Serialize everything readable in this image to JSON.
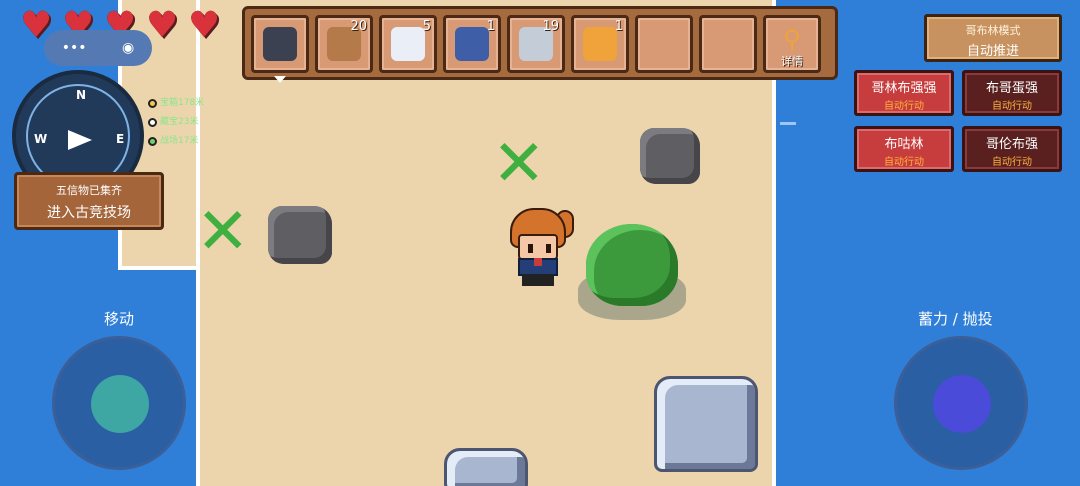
{
  "hud": {
    "hearts_count": 5,
    "mini_panel": {
      "left_glyph": "•••",
      "right_glyph": "◉"
    },
    "compass": {
      "n": "N",
      "w": "W",
      "e": "E"
    },
    "legend": [
      {
        "color": "#f2c94c",
        "text": "宝箱178米"
      },
      {
        "color": "#ffffff",
        "text": "藏宝23米"
      },
      {
        "color": "#6fd26f",
        "text": "战场17米"
      }
    ],
    "arena": {
      "top": "五信物已集齐",
      "bottom": "进入古竞技场"
    }
  },
  "hotbar": {
    "slots": [
      {
        "item": "bomb-item",
        "color": "#3b4150",
        "count": ""
      },
      {
        "item": "wood-log-item",
        "color": "#b57a4a",
        "count": "20"
      },
      {
        "item": "silver-ore-item",
        "color": "#e9eef7",
        "count": "5"
      },
      {
        "item": "fish-item",
        "color": "#3f5ea8",
        "count": "1"
      },
      {
        "item": "stone-item",
        "color": "#c4ccd8",
        "count": "19"
      },
      {
        "item": "amber-gem-item",
        "color": "#f0a33a",
        "count": "1"
      },
      {
        "item": "empty",
        "color": "",
        "count": ""
      },
      {
        "item": "empty",
        "color": "",
        "count": ""
      }
    ],
    "details_label": "详情"
  },
  "right_panel": {
    "goblin_mode": {
      "title": "哥布林模式",
      "subtitle": "自动推进"
    },
    "npcs": [
      {
        "name": "哥林布强强",
        "status": "自动行动"
      },
      {
        "name": "布哥蛋强",
        "status": "自动行动"
      },
      {
        "name": "布咕林",
        "status": "自动行动"
      },
      {
        "name": "哥伦布强",
        "status": "自动行动"
      }
    ]
  },
  "controls": {
    "move_label": "移动",
    "action_label": "蓄力 / 抛投"
  },
  "colors": {
    "ocean": "#2f7fd8",
    "sand": "#ecd5ac",
    "heart": "#d9323c",
    "move_knob": "#3ea6a3",
    "action_knob": "#4a4bd8"
  }
}
